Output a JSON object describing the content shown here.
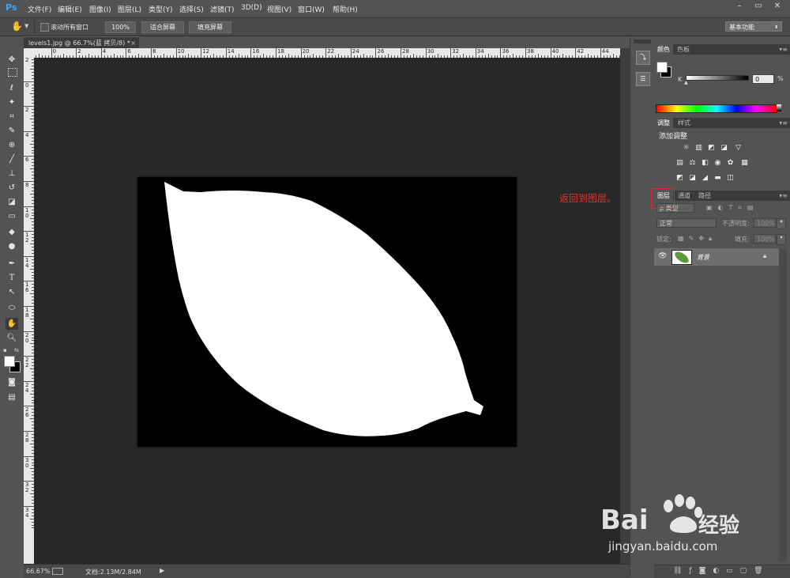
{
  "app": {
    "logo": "Ps"
  },
  "menubar": {
    "items": [
      "文件(F)",
      "编辑(E)",
      "图像(I)",
      "图层(L)",
      "类型(Y)",
      "选择(S)",
      "滤镜(T)",
      "3D(D)",
      "视图(V)",
      "窗口(W)",
      "帮助(H)"
    ]
  },
  "window_controls": [
    "–",
    "▭",
    "✕"
  ],
  "options": {
    "scroll_all_label": "滚动所有窗口",
    "zoom_100": "100%",
    "fit_screen": "适合屏幕",
    "fill_screen": "填充屏幕",
    "workspace": "基本功能"
  },
  "document": {
    "tab_title": "levels1.jpg @ 66.7%(蓝 拷贝/8) *",
    "tab_close": "×"
  },
  "rulers": {
    "h_labels": [
      "2",
      "0",
      "2",
      "4",
      "6",
      "8",
      "10",
      "12",
      "14",
      "16",
      "18",
      "20",
      "22",
      "24",
      "26",
      "28",
      "30",
      "32",
      "34",
      "36",
      "38",
      "40",
      "42",
      "44"
    ],
    "v_labels": [
      "2",
      "0",
      "2",
      "4",
      "6",
      "8",
      "1 0",
      "1 2",
      "1 4",
      "1 6",
      "1 8",
      "2 0",
      "2 2",
      "2 4",
      "2 6",
      "2 8",
      "3 0",
      "3 2",
      "3 4"
    ]
  },
  "status": {
    "zoom": "66.67%",
    "doc_size": "文档:2.13M/2.84M"
  },
  "panels": {
    "color": {
      "tabs": [
        "颜色",
        "色板"
      ],
      "channel_label": "K",
      "value": "0",
      "unit": "%"
    },
    "adjustments": {
      "tabs": [
        "调整",
        "样式"
      ],
      "title": "添加调整"
    },
    "layers": {
      "tabs": [
        "图层",
        "通道",
        "路径"
      ],
      "filter_kind": "ρ 类型",
      "blend_mode": "正常",
      "opacity_label": "不透明度:",
      "opacity_value": "100%",
      "lock_label": "锁定:",
      "fill_label": "填充:",
      "fill_value": "100%",
      "layer_name": "背景"
    }
  },
  "annotation": {
    "text": "返回到图层。"
  },
  "watermark": {
    "brand": "Bai",
    "brand2": "经验",
    "url": "jingyan.baidu.com"
  },
  "colors": {
    "accent_annotation": "#e3342f",
    "canvas_bg": "#282828",
    "leaf_thumb": "#5c9a3a"
  }
}
